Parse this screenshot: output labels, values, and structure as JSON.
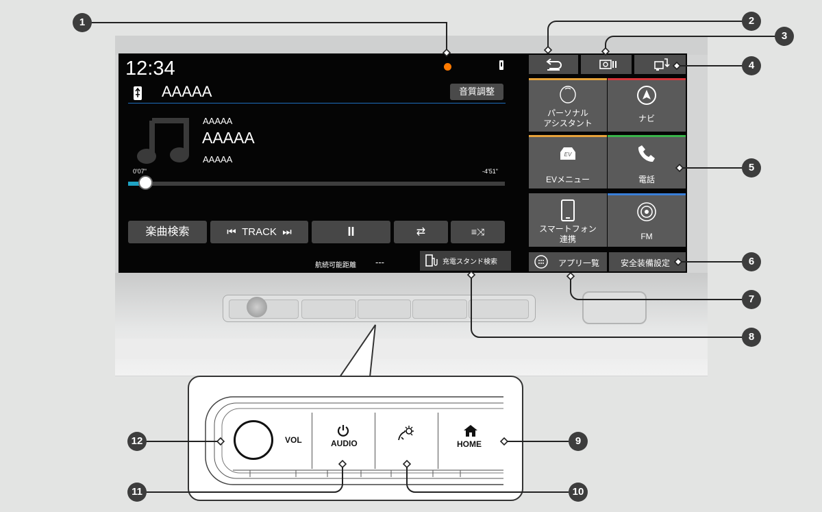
{
  "screen": {
    "clock": "12:34",
    "source_title": "AAAAA",
    "sound_button": "音質調整",
    "track": {
      "artist": "AAAAA",
      "title": "AAAAA",
      "album": "AAAAA",
      "elapsed": "0'07\"",
      "remaining": "-4'51\"",
      "progress": 0.02
    },
    "buttons": {
      "search": "楽曲検索",
      "track": "TRACK",
      "pause": "II"
    },
    "range_label": "航続可能距離",
    "range_value": "---",
    "charge_station": "充電スタンド検索"
  },
  "tiles": [
    {
      "label": "パーソナル\nアシスタント",
      "icon": "assistant-icon",
      "bar": "#e8a33a"
    },
    {
      "label": "ナビ",
      "icon": "navigation-icon",
      "bar": "#d7363b"
    },
    {
      "label": "EVメニュー",
      "icon": "ev-icon",
      "bar": "#e8a33a"
    },
    {
      "label": "電話",
      "icon": "phone-icon",
      "bar": "#39b54a"
    },
    {
      "label": "スマートフォン\n連携",
      "icon": "smartphone-icon",
      "bar": ""
    },
    {
      "label": "FM",
      "icon": "radio-icon",
      "bar": "#3a7fd8"
    }
  ],
  "apps_button": "アプリ一覧",
  "safety_button": "安全装備設定",
  "physical": {
    "vol": "VOL",
    "audio": "AUDIO",
    "home": "HOME"
  },
  "callouts": [
    "1",
    "2",
    "3",
    "4",
    "5",
    "6",
    "7",
    "8",
    "9",
    "10",
    "11",
    "12"
  ],
  "colors": {
    "notification": "#ff7a00",
    "progress": "#1fa3c4",
    "divider": "#1d6fbf"
  }
}
